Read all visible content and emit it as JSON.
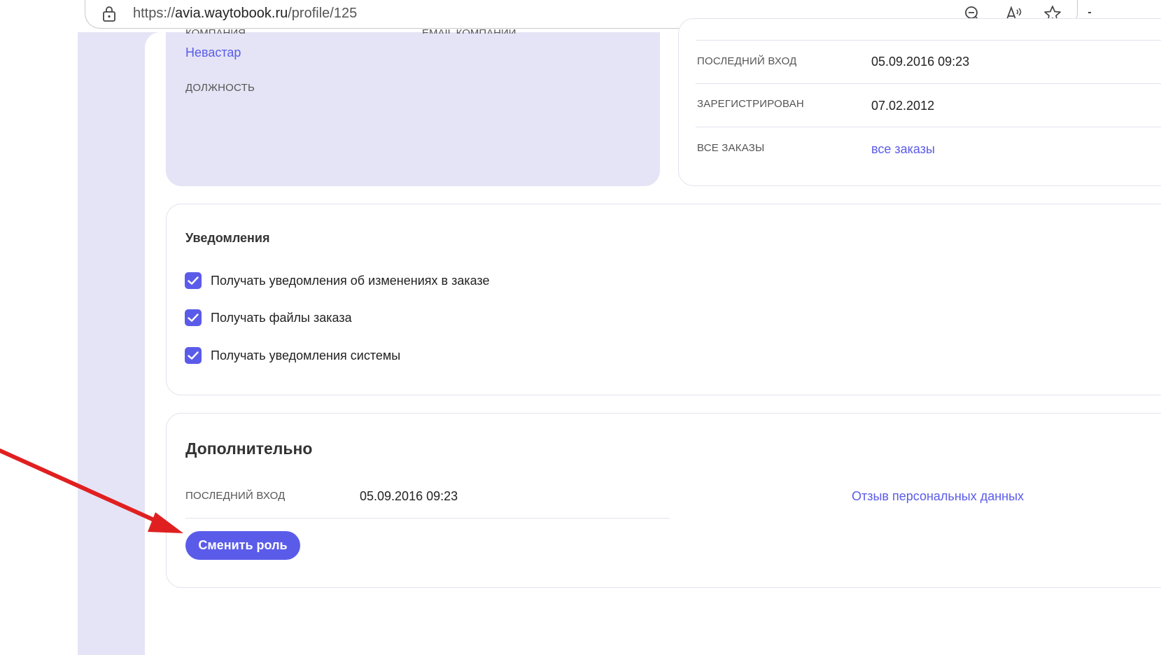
{
  "browser": {
    "url_prefix": "https://",
    "url_host": "avia.waytobook.ru",
    "url_path": "/profile/125",
    "icons": [
      "lock-icon",
      "zoom-out-icon",
      "read-aloud-icon",
      "favorite-star-icon"
    ]
  },
  "company_card": {
    "company_label_partial": "КОМПАНИЯ",
    "email_label_partial": "EMAIL КОМПАНИИ",
    "company_value": "Невастар",
    "position_label": "ДОЛЖНОСТЬ"
  },
  "stats_card": {
    "rows": [
      {
        "label": "ПОСЛЕДНИЙ ВХОД",
        "value": "05.09.2016 09:23"
      },
      {
        "label": "ЗАРЕГИСТРИРОВАН",
        "value": "07.02.2012"
      },
      {
        "label": "ВСЕ ЗАКАЗЫ",
        "link": "все заказы"
      }
    ]
  },
  "notifications": {
    "title": "Уведомления",
    "options": [
      {
        "label": "Получать уведомления об изменениях в заказе",
        "checked": true
      },
      {
        "label": "Получать файлы заказа",
        "checked": true
      },
      {
        "label": "Получать уведомления системы",
        "checked": true
      }
    ]
  },
  "extra": {
    "title": "Дополнительно",
    "last_login_label": "ПОСЛЕДНИЙ ВХОД",
    "last_login_value": "05.09.2016 09:23",
    "revoke_link": "Отзыв персональных данных",
    "change_role_button": "Сменить роль"
  },
  "colors": {
    "accent": "#5b5bea",
    "lavender": "#e4e4f6",
    "annotation_arrow": "#e02020"
  }
}
